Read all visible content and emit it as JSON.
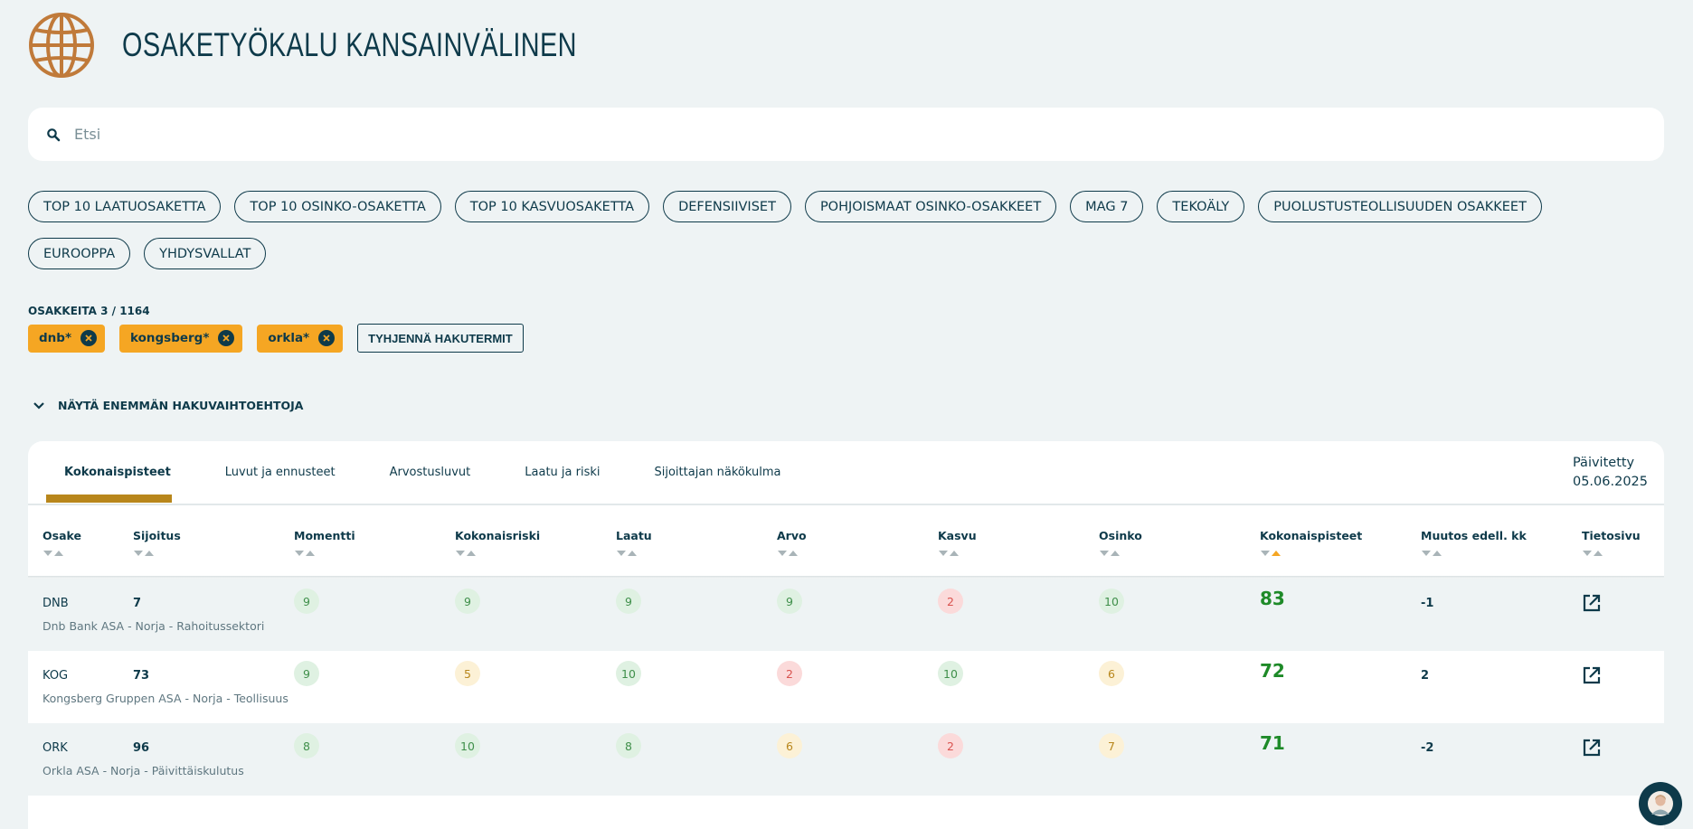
{
  "app": {
    "title": "OSAKETYÖKALU KANSAINVÄLINEN",
    "logo_icon": "globe-icon",
    "accent": "#c07a3a"
  },
  "search": {
    "placeholder": "Etsi",
    "value": ""
  },
  "presets": {
    "row1": [
      "TOP 10 LAATUOSAKETTA",
      "TOP 10 OSINKO-OSAKETTA",
      "TOP 10 KASVUOSAKETTA",
      "DEFENSIIVISET",
      "POHJOISMAAT OSINKO-OSAKKEET",
      "MAG 7",
      "TEKOÄLY",
      "PUOLUSTUSTEOLLISUUDEN OSAKKEET"
    ],
    "row2": [
      "EUROOPPA",
      "YHDYSVALLAT"
    ]
  },
  "results": {
    "count_label": "OSAKKEITA 3 / 1164",
    "tags": [
      "dnb*",
      "kongsberg*",
      "orkla*"
    ],
    "clear_label": "TYHJENNÄ HAKUTERMIT"
  },
  "more_options_label": "NÄYTÄ ENEMMÄN HAKUVAIHTOEHTOJA",
  "tabs": [
    "Kokonaispisteet",
    "Luvut ja ennusteet",
    "Arvostusluvut",
    "Laatu ja riski",
    "Sijoittajan näkökulma"
  ],
  "active_tab": "Kokonaispisteet",
  "updated": {
    "label": "Päivitetty",
    "date": "05.06.2025"
  },
  "columns": [
    "Osake",
    "Sijoitus",
    "Momentti",
    "Kokonaisriski",
    "Laatu",
    "Arvo",
    "Kasvu",
    "Osinko",
    "Kokonaispisteet",
    "Muutos edell. kk",
    "Tietosivu"
  ],
  "sorted_column": "Kokonaispisteet",
  "rows": [
    {
      "ticker": "DNB",
      "rank": "7",
      "description": "Dnb Bank ASA - Norja - Rahoitussektori",
      "scores": [
        "9",
        "9",
        "9",
        "9",
        "2",
        "10"
      ],
      "total": "83",
      "change": "-1"
    },
    {
      "ticker": "KOG",
      "rank": "73",
      "description": "Kongsberg Gruppen ASA - Norja - Teollisuus",
      "scores": [
        "9",
        "5",
        "10",
        "2",
        "10",
        "6"
      ],
      "total": "72",
      "change": "2"
    },
    {
      "ticker": "ORK",
      "rank": "96",
      "description": "Orkla ASA - Norja - Päivittäiskulutus",
      "scores": [
        "8",
        "10",
        "8",
        "6",
        "2",
        "7"
      ],
      "total": "71",
      "change": "-2"
    }
  ],
  "colors": {
    "good": "#3f8f4a",
    "mid": "#b8861b",
    "bad": "#d9534f",
    "tag": "#f5a623",
    "total": "#1e8a28"
  }
}
